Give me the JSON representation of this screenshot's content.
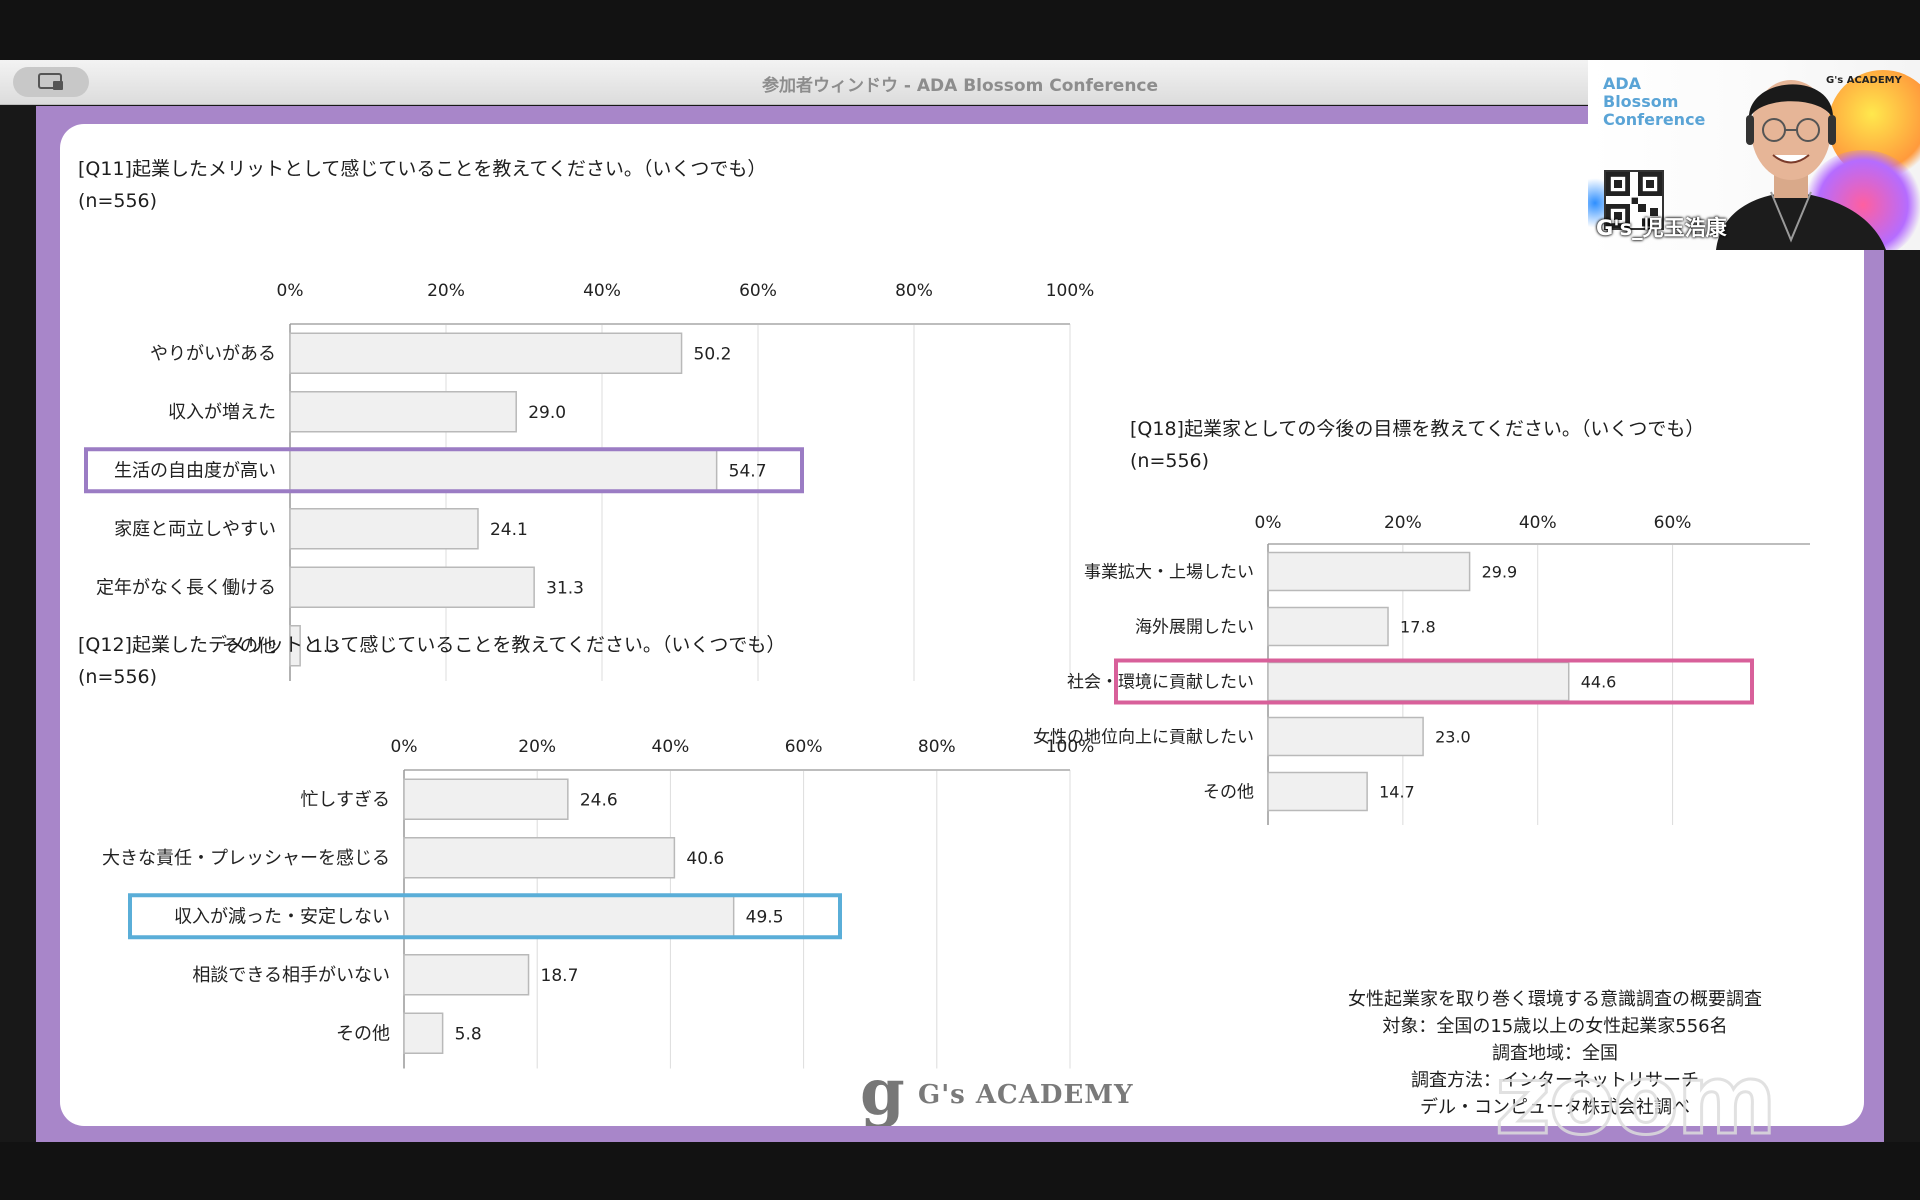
{
  "window": {
    "title": "参加者ウィンドウ - ADA Blossom Conference"
  },
  "camera": {
    "participant_name": "G's_児玉浩康",
    "poster_lines": [
      "ADA",
      "Blossom",
      "Conference"
    ],
    "poster_brand": "G's ACADEMY"
  },
  "charts": {
    "q11": {
      "title": "[Q11]起業したメリットとして感じていることを教えてください。（いくつでも）",
      "n": "(n=556)",
      "highlight_color": "#9b7cc4"
    },
    "q12": {
      "title": "[Q12]起業したデメリットとして感じていることを教えてください。（いくつでも）",
      "n": "(n=556)",
      "highlight_color": "#5aaed8"
    },
    "q18": {
      "title": "[Q18]起業家としての今後の目標を教えてください。（いくつでも）",
      "n": "(n=556)",
      "highlight_color": "#d8609a"
    }
  },
  "chart_data": [
    {
      "type": "bar",
      "orientation": "horizontal",
      "title": "[Q11]起業したメリットとして感じていることを教えてください。（いくつでも）",
      "categories": [
        "やりがいがある",
        "収入が増えた",
        "生活の自由度が高い",
        "家庭と両立しやすい",
        "定年がなく長く働ける",
        "その他"
      ],
      "values": [
        50.2,
        29.0,
        54.7,
        24.1,
        31.3,
        1.3
      ],
      "labels": [
        "50.2",
        "29.0",
        "54.7",
        "24.1",
        "31.3",
        "1.3"
      ],
      "ticks": [
        "0%",
        "20%",
        "40%",
        "60%",
        "80%",
        "100%"
      ],
      "xlim": [
        0,
        100
      ],
      "highlight_index": 2
    },
    {
      "type": "bar",
      "orientation": "horizontal",
      "title": "[Q12]起業したデメリットとして感じていることを教えてください。（いくつでも）",
      "categories": [
        "忙しすぎる",
        "大きな責任・プレッシャーを感じる",
        "収入が減った・安定しない",
        "相談できる相手がいない",
        "その他"
      ],
      "values": [
        24.6,
        40.6,
        49.5,
        18.7,
        5.8
      ],
      "labels": [
        "24.6",
        "40.6",
        "49.5",
        "18.7",
        "5.8"
      ],
      "ticks": [
        "0%",
        "20%",
        "40%",
        "60%",
        "80%",
        "100%"
      ],
      "xlim": [
        0,
        100
      ],
      "highlight_index": 2
    },
    {
      "type": "bar",
      "orientation": "horizontal",
      "title": "[Q18]起業家としての今後の目標を教えてください。（いくつでも）",
      "categories": [
        "事業拡大・上場したい",
        "海外展開したい",
        "社会・環境に貢献したい",
        "女性の地位向上に貢献したい",
        "その他"
      ],
      "values": [
        29.9,
        17.8,
        44.6,
        23.0,
        14.7
      ],
      "labels": [
        "29.9",
        "17.8",
        "44.6",
        "23.0",
        "14.7"
      ],
      "ticks": [
        "0%",
        "20%",
        "40%",
        "60%"
      ],
      "xlim": [
        0,
        70
      ],
      "highlight_index": 2
    }
  ],
  "survey_info": {
    "lines": [
      "女性起業家を取り巻く環境する意識調査の概要調査",
      "対象：全国の15歳以上の女性起業家556名",
      "調査地域：全国",
      "調査方法：インターネットリサーチ",
      "デル・コンピュータ株式会社調べ"
    ]
  },
  "footer": {
    "logo_letter": "g",
    "logo_text": "G's ACADEMY",
    "zoom_watermark": "zoom"
  }
}
